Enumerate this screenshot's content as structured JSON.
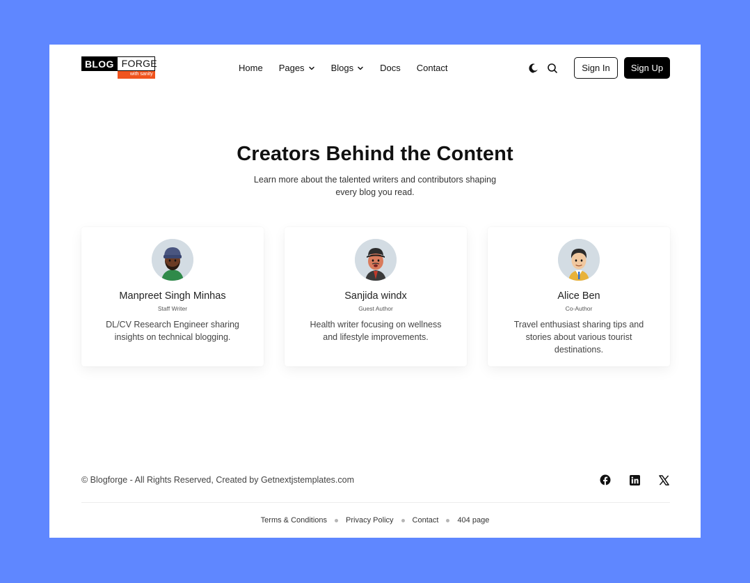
{
  "colors": {
    "background": "#5f87ff",
    "accent": "#f0541e",
    "primary_button": "#000000"
  },
  "header": {
    "logo": {
      "word1": "BLOG",
      "word2": "FORGE",
      "tagline": "with sanity"
    },
    "nav": [
      {
        "label": "Home",
        "has_dropdown": false
      },
      {
        "label": "Pages",
        "has_dropdown": true
      },
      {
        "label": "Blogs",
        "has_dropdown": true
      },
      {
        "label": "Docs",
        "has_dropdown": false
      },
      {
        "label": "Contact",
        "has_dropdown": false
      }
    ],
    "icons": [
      "theme-toggle-icon",
      "search-icon"
    ],
    "sign_in": "Sign In",
    "sign_up": "Sign Up"
  },
  "hero": {
    "title": "Creators Behind the Content",
    "subtitle": "Learn more about the talented writers and contributors shaping every blog you read."
  },
  "authors": [
    {
      "name": "Manpreet Singh Minhas",
      "role": "Staff Writer",
      "bio": "DL/CV Research Engineer sharing insights on technical blogging."
    },
    {
      "name": "Sanjida windx",
      "role": "Guest Author",
      "bio": "Health writer focusing on wellness and lifestyle improvements."
    },
    {
      "name": "Alice Ben",
      "role": "Co-Author",
      "bio": "Travel enthusiast sharing tips and stories about various tourist destinations."
    }
  ],
  "footer": {
    "copyright": "© Blogforge - All Rights Reserved, Created by Getnextjstemplates.com",
    "social": [
      "facebook-icon",
      "linkedin-icon",
      "x-icon"
    ],
    "links": [
      "Terms & Conditions",
      "Privacy Policy",
      "Contact",
      "404 page"
    ]
  }
}
